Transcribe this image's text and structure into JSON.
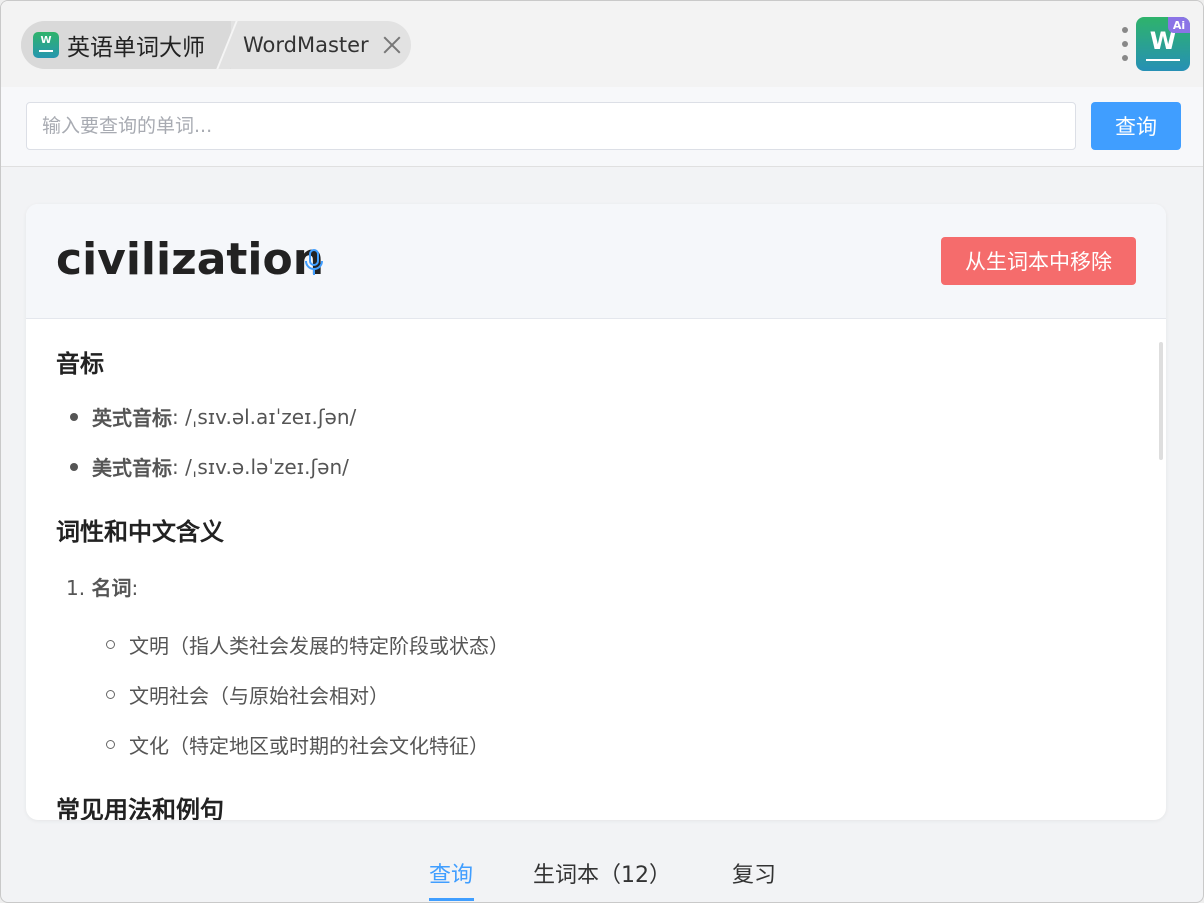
{
  "titlebar": {
    "app_title": "英语单词大师",
    "app_icon_letter": "W",
    "tab_title": "WordMaster",
    "ai_logo_letter": "W",
    "ai_badge": "Ai"
  },
  "search": {
    "placeholder": "输入要查询的单词...",
    "button_label": "查询"
  },
  "word": {
    "title": "civilization",
    "remove_button": "从生词本中移除"
  },
  "sections": {
    "phonetics_heading": "音标",
    "phonetics": [
      {
        "label": "英式音标",
        "value": ": /ˌsɪv.əl.aɪˈzeɪ.ʃən/"
      },
      {
        "label": "美式音标",
        "value": ": /ˌsɪv.ə.ləˈzeɪ.ʃən/"
      }
    ],
    "meaning_heading": "词性和中文含义",
    "pos": {
      "number": "1.",
      "label": "名词",
      "suffix": ":"
    },
    "meanings": [
      "文明（指人类社会发展的特定阶段或状态）",
      "文明社会（与原始社会相对）",
      "文化（特定地区或时期的社会文化特征）"
    ],
    "usage_heading": "常见用法和例句"
  },
  "nav": {
    "items": [
      "查询",
      "生词本（12）",
      "复习"
    ],
    "active_index": 0
  },
  "colors": {
    "primary": "#409eff",
    "danger": "#f56c6c",
    "ai_badge": "#8b74e6"
  }
}
